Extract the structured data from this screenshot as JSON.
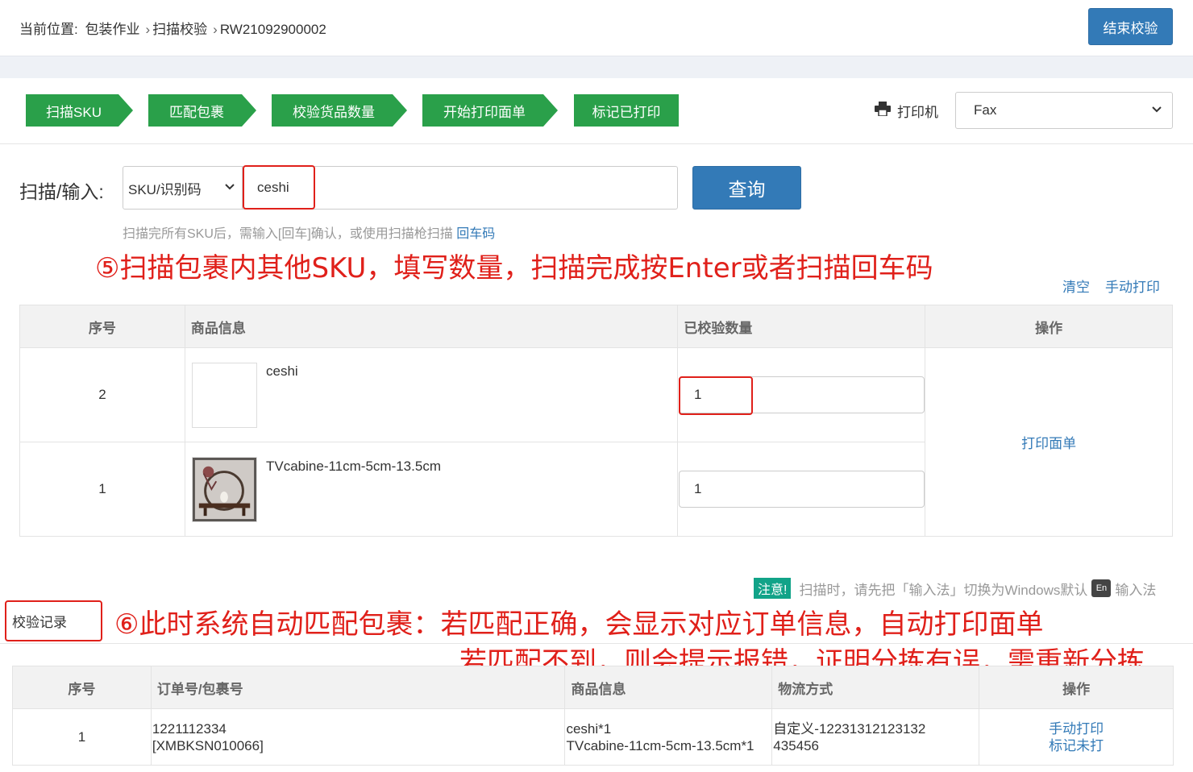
{
  "breadcrumb": {
    "label": "当前位置:",
    "items": [
      "包装作业",
      "扫描校验",
      "RW21092900002"
    ]
  },
  "header": {
    "end_button": "结束校验"
  },
  "steps": [
    "扫描SKU",
    "匹配包裹",
    "校验货品数量",
    "开始打印面单",
    "标记已打印"
  ],
  "printer": {
    "label": "打印机",
    "selected": "Fax",
    "icon": "printer-icon"
  },
  "scan": {
    "label": "扫描/输入:",
    "type_selected": "SKU/识别码",
    "value": "ceshi",
    "query_button": "查询",
    "hint": "扫描完所有SKU后，需输入[回车]确认，或使用扫描枪扫描",
    "hint_link": "回车码"
  },
  "annotations": {
    "step5": "⑤扫描包裹内其他SKU，填写数量，扫描完成按Enter或者扫描回车码",
    "step6_line1": "⑥此时系统自动匹配包裹：若匹配正确，会显示对应订单信息，自动打印面单",
    "step6_line2": "若匹配不到，则会提示报错，证明分拣有误，需重新分拣"
  },
  "actions": {
    "clear": "清空",
    "manual_print": "手动打印"
  },
  "sku_table": {
    "headers": [
      "序号",
      "商品信息",
      "已校验数量",
      "操作"
    ],
    "rows": [
      {
        "index": "2",
        "name": "ceshi",
        "qty": "1"
      },
      {
        "index": "1",
        "name": "TVcabine-11cm-5cm-13.5cm",
        "qty": "1"
      }
    ],
    "action": "打印面单"
  },
  "notice": {
    "tag": "注意!",
    "text": "扫描时，请先把「输入法」切换为Windows默认",
    "en_badge": "En",
    "suffix": "输入法"
  },
  "log": {
    "tab": "校验记录",
    "headers": [
      "序号",
      "订单号/包裹号",
      "商品信息",
      "物流方式",
      "操作"
    ],
    "rows": [
      {
        "index": "1",
        "order": "1221112334",
        "package": "[XMBKSN010066]",
        "goods1": "ceshi*1",
        "goods2": "TVcabine-11cm-5cm-13.5cm*1",
        "shipping1": "自定义-12231312123132",
        "shipping2": "435456",
        "action1": "手动打印",
        "action2": "标记未打"
      }
    ]
  },
  "colors": {
    "primary": "#337ab7",
    "step_green": "#2aa04a",
    "annotation_red": "#e0201a",
    "notice_tag": "#11a388"
  }
}
